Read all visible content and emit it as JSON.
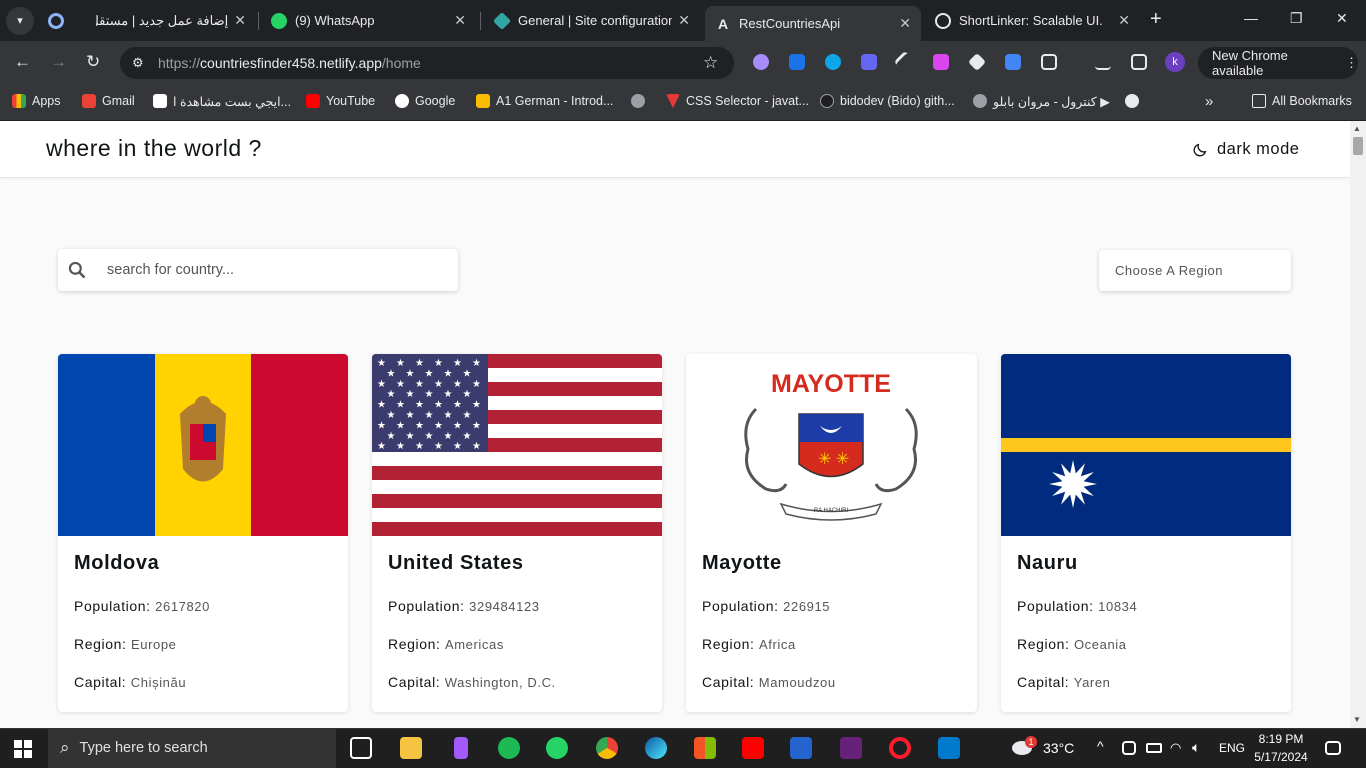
{
  "browser": {
    "tabs": [
      {
        "label": "إضافة عمل جديد | مستقل",
        "icon": "mostaql-icon",
        "close": "✕"
      },
      {
        "label": "(9) WhatsApp",
        "icon": "whatsapp-icon",
        "close": "✕"
      },
      {
        "label": "General | Site configuration |",
        "icon": "netlify-icon",
        "close": "✕"
      },
      {
        "label": "RestCountriesApi",
        "icon": "angular-icon",
        "close": "✕",
        "active": true
      },
      {
        "label": "ShortLinker: Scalable UI.",
        "icon": "openai-icon",
        "close": "✕"
      }
    ],
    "url_scheme": "https://",
    "url_host": "countriesfinder458.netlify.app",
    "url_path": "/home",
    "profile_initial": "k",
    "update_label": "New Chrome available",
    "bookmarks": [
      {
        "label": "Apps",
        "icon": "apps-grid-icon"
      },
      {
        "label": "Gmail",
        "icon": "gmail-icon"
      },
      {
        "label": "ايجي بست مشاهدة ا...",
        "icon": "egybest-icon"
      },
      {
        "label": "YouTube",
        "icon": "youtube-icon"
      },
      {
        "label": "Google",
        "icon": "google-icon"
      },
      {
        "label": "A1 German - Introd...",
        "icon": "a1-german-icon"
      },
      {
        "label": "",
        "icon": "globe-icon"
      },
      {
        "label": "CSS Selector - javat...",
        "icon": "css-selector-icon"
      },
      {
        "label": "bidodev (Bido) gith...",
        "icon": "github-icon"
      },
      {
        "label": "كنترول - مروان بابلو ▶",
        "icon": "globe-icon"
      },
      {
        "label": "",
        "icon": "smiley-icon"
      }
    ],
    "all_bookmarks": "All Bookmarks",
    "overflow": "»"
  },
  "app": {
    "title": "where in the world ?",
    "dark_mode_label": "dark mode",
    "search_placeholder": "search for country...",
    "region_placeholder": "Choose A Region",
    "labels": {
      "population": "Population:",
      "region": "Region:",
      "capital": "Capital:"
    }
  },
  "countries": [
    {
      "name": "Moldova",
      "population": "2617820",
      "region": "Europe",
      "capital": "Chișinău",
      "flag": "moldova-flag"
    },
    {
      "name": "United States",
      "population": "329484123",
      "region": "Americas",
      "capital": "Washington, D.C.",
      "flag": "united-states-flag"
    },
    {
      "name": "Mayotte",
      "population": "226915",
      "region": "Africa",
      "capital": "Mamoudzou",
      "flag": "mayotte-flag",
      "flag_text": "MAYOTTE",
      "flag_motto": "RA HACHIRI"
    },
    {
      "name": "Nauru",
      "population": "10834",
      "region": "Oceania",
      "capital": "Yaren",
      "flag": "nauru-flag"
    }
  ],
  "taskbar": {
    "search_placeholder": "Type here to search",
    "weather": "33°C",
    "language": "ENG",
    "time": "8:19 PM",
    "date": "5/17/2024",
    "weather_badge": "1"
  },
  "colors": {
    "chrome_dark": "#202124",
    "chrome_toolbar": "#35363a",
    "page_background": "#fafafa",
    "card_background": "#ffffff",
    "text_primary": "#111517"
  }
}
